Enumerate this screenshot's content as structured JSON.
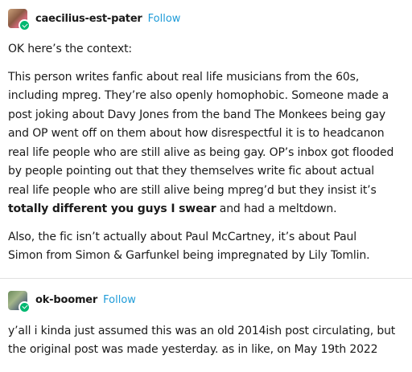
{
  "post1": {
    "username": "caecilius-est-pater",
    "follow_label": "Follow",
    "p1": "OK here’s the context:",
    "p2_lines": [
      "This person writes fanfic about real life musicians from the 60s,",
      "including mpreg. They’re also openly homophobic. Someone made a",
      "post joking about Davy Jones from the band The Monkees being gay",
      "and OP went off on them about how disrespectful it is to headcanon",
      "real life people who are still alive as being gay. OP’s inbox got flooded",
      "by people pointing out that they themselves write fic about actual",
      "real life people who are still alive being mpreg’d but they insist it’s"
    ],
    "p2_bold": "totally different you guys I swear",
    "p2_tail": " and had a meltdown.",
    "p3_lines": [
      "Also, the fic isn’t actually about Paul McCartney, it’s about Paul",
      "Simon from Simon & Garfunkel being impregnated by Lily Tomlin."
    ]
  },
  "post2": {
    "username": "ok-boomer",
    "follow_label": "Follow",
    "p1_lines": [
      "y’all i kinda just assumed this was an old 2014ish post circulating, but",
      "the original post was made yesterday. as in like, on May 19th 2022"
    ]
  },
  "colors": {
    "follow": "#1e9bd8",
    "badge": "#00b871",
    "text": "#1a1a1a"
  },
  "icons": [
    "avatar",
    "verified-check-icon"
  ]
}
